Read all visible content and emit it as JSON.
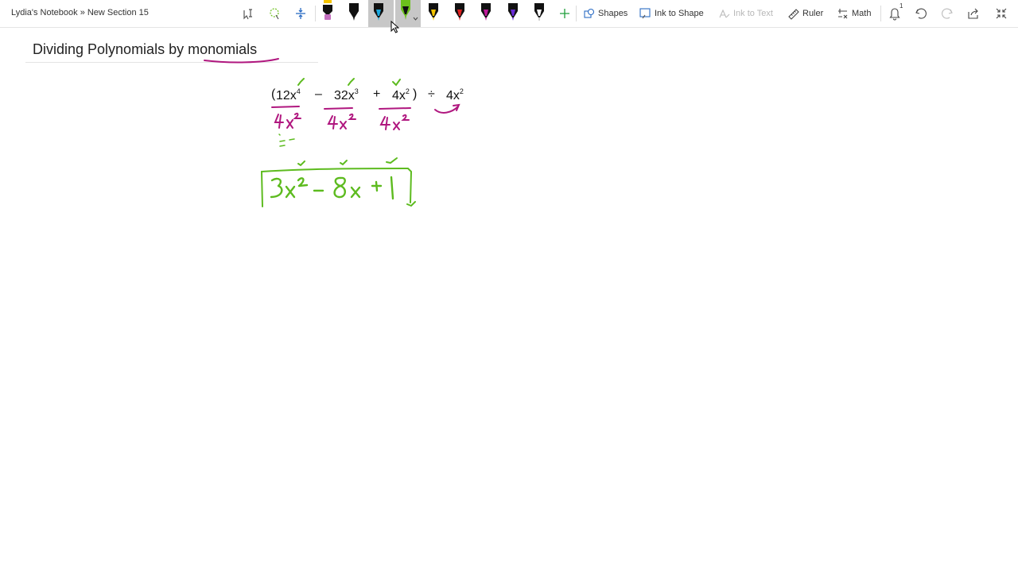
{
  "breadcrumb": "Lydia's Notebook » New Section 15",
  "toolbar": {
    "shapes_label": "Shapes",
    "ink_to_shape_label": "Ink to Shape",
    "ink_to_text_label": "Ink to Text",
    "ruler_label": "Ruler",
    "math_label": "Math",
    "notification_count": "1",
    "pens": [
      {
        "color": "#000000",
        "cap": "#c36fbf",
        "kind": "highlighter"
      },
      {
        "color": "#000000",
        "cap": "#000000",
        "kind": "pen"
      },
      {
        "color": "#1aa9e0",
        "cap": "#1aa9e0",
        "kind": "pen",
        "selected": true
      },
      {
        "color": "#6cc11c",
        "cap": "#6cc11c",
        "kind": "pen",
        "selected": true
      },
      {
        "color": "#f5c400",
        "cap": "#f5c400",
        "kind": "pen"
      },
      {
        "color": "#e02020",
        "cap": "#e02020",
        "kind": "pen"
      },
      {
        "color": "#c0189a",
        "cap": "#c0189a",
        "kind": "pen"
      },
      {
        "color": "#6a2bd6",
        "cap": "#6a2bd6",
        "kind": "pen"
      },
      {
        "color": "#ffffff",
        "cap": "#222222",
        "kind": "pen"
      }
    ]
  },
  "page": {
    "title_part1": "Dividing Polynomials by ",
    "title_part2": "monomials",
    "expression": {
      "open_paren": "(",
      "term1": "12x",
      "term1_exp": "4",
      "minus": "–",
      "term2": "32x",
      "term2_exp": "3",
      "plus": "+",
      "term3": "4x",
      "term3_exp": "2",
      "close_paren": ")",
      "divide": "÷",
      "divisor": "4x",
      "divisor_exp": "2"
    }
  },
  "ink_colors": {
    "green": "#5dbb1f",
    "magenta": "#b0177f",
    "title_underline": "#b0177f"
  }
}
